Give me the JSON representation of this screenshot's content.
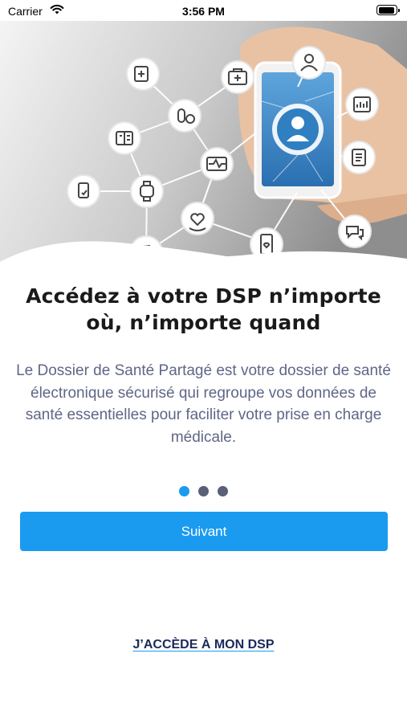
{
  "status_bar": {
    "carrier": "Carrier",
    "time": "3:56 PM",
    "icons": [
      "wifi-icon",
      "battery-icon"
    ]
  },
  "hero": {
    "icons": [
      "medical-folder-icon",
      "first-aid-kit-icon",
      "doctor-icon",
      "pills-icon",
      "medical-record-icon",
      "report-icon",
      "heartbeat-icon",
      "document-icon",
      "hand-device-icon",
      "smartwatch-icon",
      "heart-care-icon",
      "chat-icon",
      "ambulance-icon",
      "phone-heart-icon",
      "smartphone-doctor-icon"
    ],
    "colors": {
      "bubble_fill": "#ffffff",
      "line": "#ffffff",
      "phone_screen": "#2f7fc1"
    }
  },
  "onboarding": {
    "title": "Accédez à votre DSP n’importe où, n’importe quand",
    "description": "Le Dossier de Santé Partagé est votre dossier de santé électronique sécurisé qui regroupe vos données de santé essentielles pour faciliter votre prise en charge médicale.",
    "page_index": 1,
    "page_count": 3
  },
  "actions": {
    "next_label": "Suivant",
    "access_label": "J’ACCÈDE À MON DSP"
  },
  "colors": {
    "accent": "#1a9bf0",
    "title": "#1a1a1a",
    "body_text": "#5f6687",
    "link_text": "#1a2a5a"
  }
}
